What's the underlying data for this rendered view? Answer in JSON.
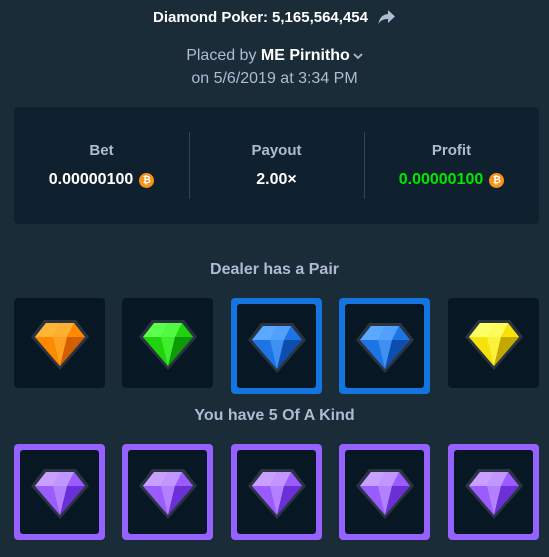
{
  "header": {
    "game": "Diamond Poker:",
    "bet_id": "5,165,564,454"
  },
  "placed": {
    "prefix": "Placed by",
    "user": "ME Pirnitho",
    "date_line": "on 5/6/2019 at 3:34 PM"
  },
  "stats": {
    "bet_label": "Bet",
    "bet_value": "0.00000100",
    "payout_label": "Payout",
    "payout_value": "2.00×",
    "profit_label": "Profit",
    "profit_value": "0.00000100",
    "currency_icon": "bitcoin-icon"
  },
  "dealer": {
    "title": "Dealer has a Pair",
    "gems": [
      {
        "color": "orange",
        "selected": false
      },
      {
        "color": "green",
        "selected": false
      },
      {
        "color": "blue",
        "selected": true
      },
      {
        "color": "blue",
        "selected": true
      },
      {
        "color": "yellow",
        "selected": false
      }
    ]
  },
  "player": {
    "title": "You have 5 Of A Kind",
    "gems": [
      {
        "color": "purple",
        "selected": true
      },
      {
        "color": "purple",
        "selected": true
      },
      {
        "color": "purple",
        "selected": true
      },
      {
        "color": "purple",
        "selected": true
      },
      {
        "color": "purple",
        "selected": true
      }
    ]
  },
  "colors": {
    "background": "#1a2c38",
    "panel": "#0f212e",
    "profit": "#00e701",
    "selected_blue": "#1475e1",
    "selected_purple": "#9562ff"
  }
}
